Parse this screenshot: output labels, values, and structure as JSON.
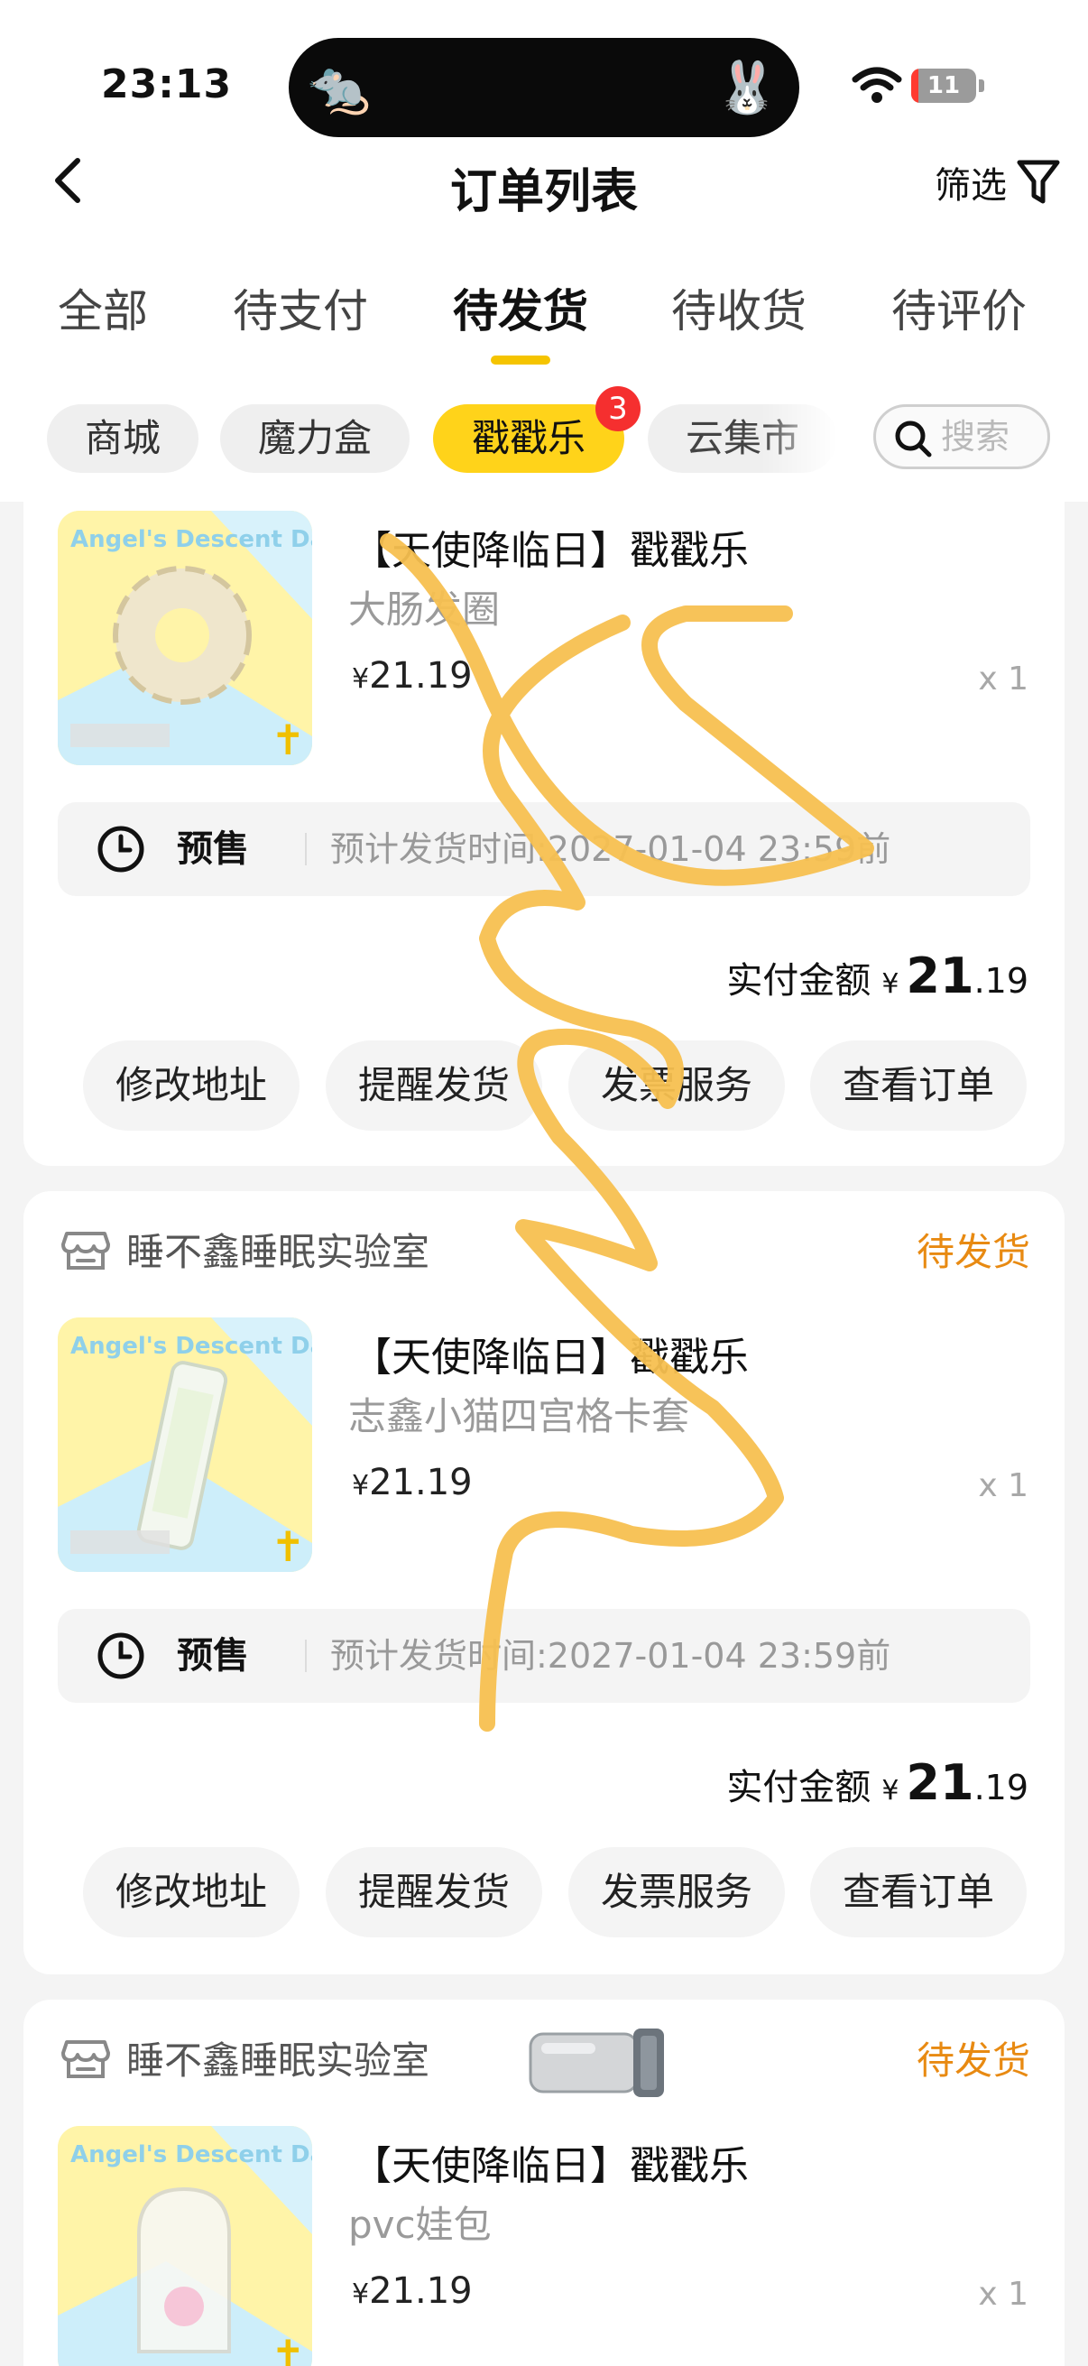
{
  "status_bar": {
    "time": "23:13",
    "battery": "11",
    "battery_level": 0.11
  },
  "nav": {
    "back_icon": "chevron-left-icon",
    "title": "订单列表",
    "filter_label": "筛选",
    "filter_icon": "filter-funnel-icon"
  },
  "tabs": [
    "全部",
    "待支付",
    "待发货",
    "待收货",
    "待评价"
  ],
  "active_tab": "待发货",
  "chips": [
    "商城",
    "魔力盒",
    "戳戳乐",
    "云集市"
  ],
  "active_chip": "戳戳乐",
  "chip_badge": "3",
  "search": {
    "placeholder": "搜索"
  },
  "orders": [
    {
      "shop": "",
      "status": "",
      "title": "【天使降临日】戳戳乐",
      "subtitle": "大肠发圈",
      "price": "21.19",
      "qty": "x 1",
      "presale_label": "预售",
      "eta": "预计发货时间:2027-01-04 23:59前",
      "paid_label": "实付金额",
      "paid_yen": "¥",
      "paid_int": "21",
      "paid_dec": ".19",
      "buttons": [
        "修改地址",
        "提醒发货",
        "发票服务",
        "查看订单"
      ]
    },
    {
      "shop": "睡不鑫睡眠实验室",
      "status": "待发货",
      "title": "【天使降临日】戳戳乐",
      "subtitle": "志鑫小猫四宫格卡套",
      "price": "21.19",
      "qty": "x 1",
      "presale_label": "预售",
      "eta": "预计发货时间:2027-01-04 23:59前",
      "paid_label": "实付金额",
      "paid_yen": "¥",
      "paid_int": "21",
      "paid_dec": ".19",
      "buttons": [
        "修改地址",
        "提醒发货",
        "发票服务",
        "查看订单"
      ]
    },
    {
      "shop": "睡不鑫睡眠实验室",
      "status": "待发货",
      "title": "【天使降临日】戳戳乐",
      "subtitle": "pvc娃包",
      "price": "21.19",
      "qty": "x 1"
    }
  ],
  "thumb_brand": "Angel's Descent Day",
  "colors": {
    "accent": "#ffd31a",
    "status": "#e88a12",
    "badge": "#f52f2f",
    "scribble": "#f7c050"
  }
}
